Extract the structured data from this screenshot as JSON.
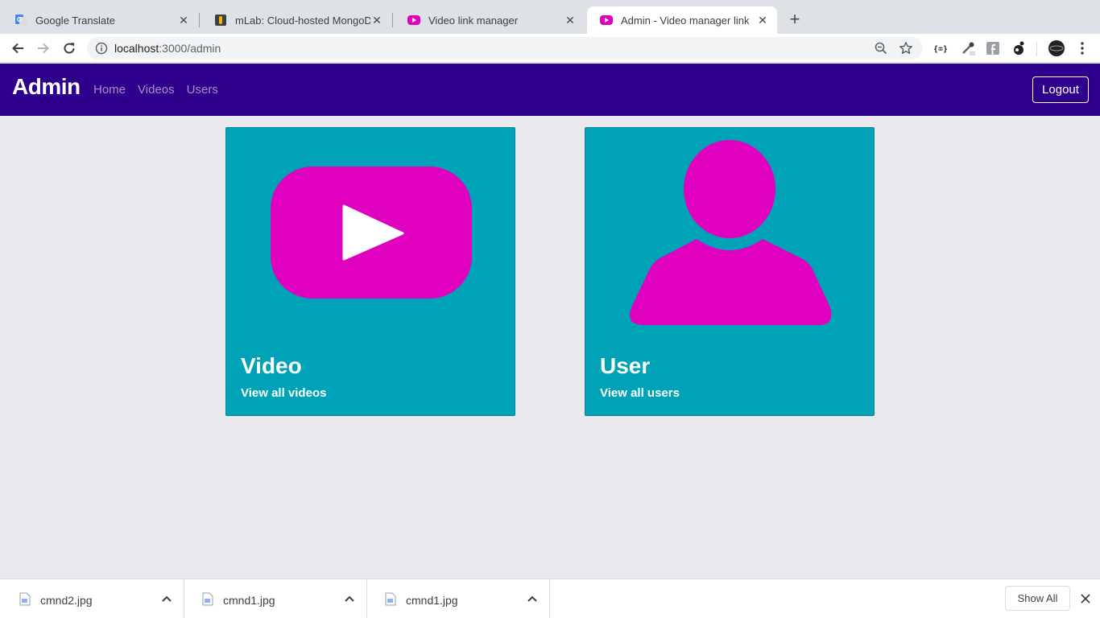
{
  "browser": {
    "tabs": [
      {
        "title": "Google Translate",
        "icon": "google-translate-icon"
      },
      {
        "title": "mLab: Cloud-hosted MongoDB",
        "icon": "mlab-icon"
      },
      {
        "title": "Video link manager",
        "icon": "video-play-icon"
      },
      {
        "title": "Admin - Video manager link",
        "icon": "video-play-icon",
        "active": true
      }
    ],
    "url_host": "localhost",
    "url_path": ":3000/admin"
  },
  "navbar": {
    "brand": "Admin",
    "links": [
      "Home",
      "Videos",
      "Users"
    ],
    "logout": "Logout",
    "bg_color": "#2e008b"
  },
  "cards": [
    {
      "title": "Video",
      "link": "View all videos",
      "icon": "play-button-icon"
    },
    {
      "title": "User",
      "link": "View all users",
      "icon": "user-silhouette-icon"
    }
  ],
  "colors": {
    "card_bg": "#00a2b8",
    "icon_magenta": "#e000c0"
  },
  "downloads": {
    "files": [
      "cmnd2.jpg",
      "cmnd1.jpg",
      "cmnd1.jpg"
    ],
    "show_all": "Show All"
  }
}
